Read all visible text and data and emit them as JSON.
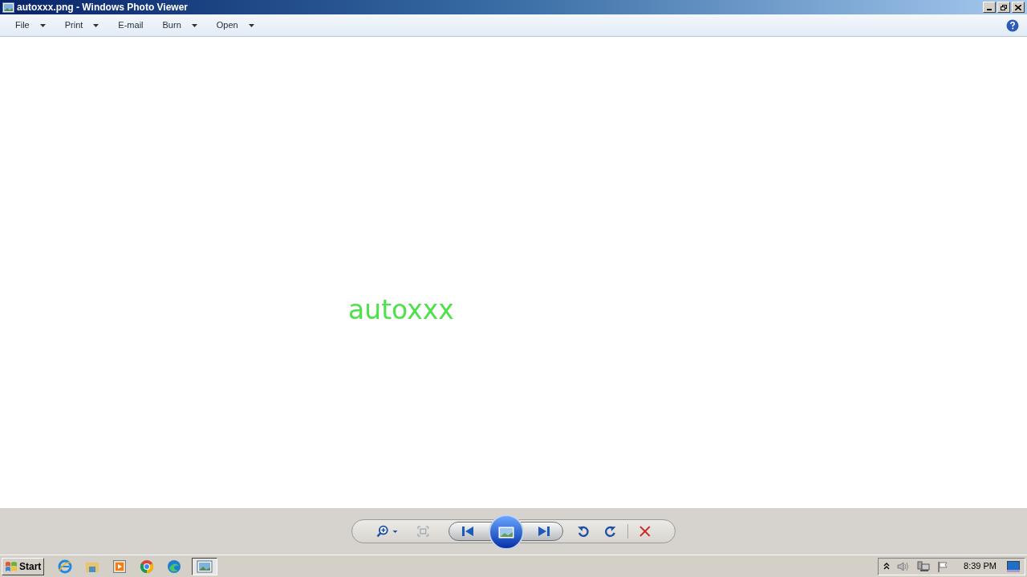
{
  "window": {
    "title": "autoxxx.png - Windows Photo Viewer"
  },
  "menu": [
    {
      "label": "File",
      "dropdown": true
    },
    {
      "label": "Print",
      "dropdown": true
    },
    {
      "label": "E-mail",
      "dropdown": false
    },
    {
      "label": "Burn",
      "dropdown": true
    },
    {
      "label": "Open",
      "dropdown": true
    }
  ],
  "image": {
    "text": "autoxxx"
  },
  "taskbar": {
    "start": "Start",
    "apps": [
      {
        "kind": "ie",
        "selected": false
      },
      {
        "kind": "folder",
        "selected": false
      },
      {
        "kind": "media",
        "selected": false
      },
      {
        "kind": "chrome",
        "selected": false
      },
      {
        "kind": "edge",
        "selected": false
      },
      {
        "kind": "photo",
        "selected": true
      }
    ],
    "clock": "8:39 PM"
  }
}
